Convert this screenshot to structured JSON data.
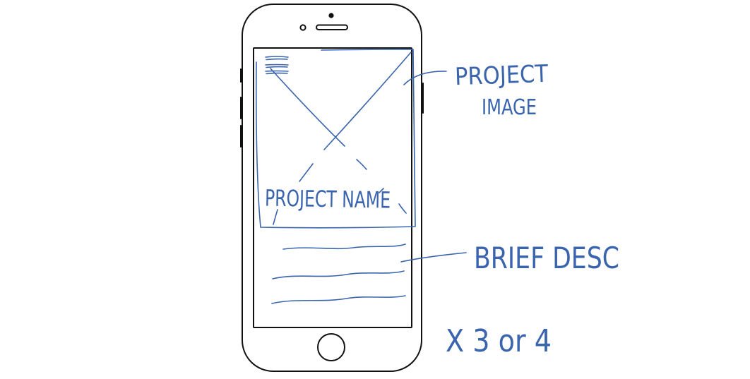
{
  "labels": {
    "project_image": [
      "PROJECT",
      "IMAGE"
    ],
    "project_name": "PROJECT NAME",
    "brief_desc": "BRIEF DESC",
    "multiplier": "X 3 or 4"
  },
  "colors": {
    "ink": "#3a64ad",
    "phone": "#111111",
    "background": "#ffffff"
  },
  "icons": {
    "menu": "hamburger-menu-icon",
    "image_placeholder": "image-placeholder-icon",
    "home_button": "home-button-icon",
    "speaker": "speaker-icon",
    "camera": "front-camera-icon"
  }
}
